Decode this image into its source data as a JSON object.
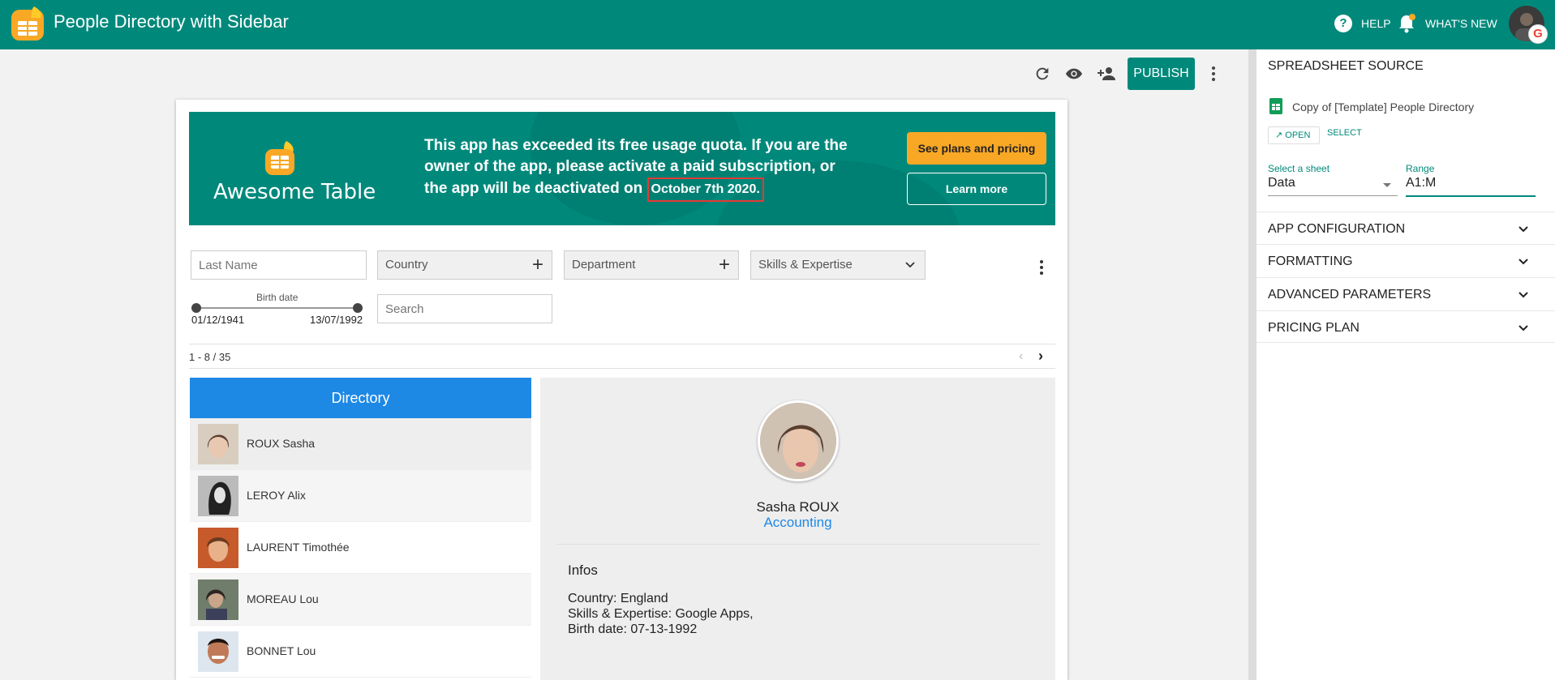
{
  "app": {
    "title": "People Directory with Sidebar"
  },
  "topbar": {
    "help_label": "HELP",
    "whats_new_label": "WHAT'S NEW",
    "google_badge": "G"
  },
  "toolbar": {
    "publish_label": "PUBLISH"
  },
  "banner": {
    "brand": "Awesome Table",
    "message": "This app has exceeded its free usage quota. If you are the owner of the app, please activate a paid subscription, or the app will be deactivated on",
    "date": "October 7th 2020.",
    "plans_label": "See plans and pricing",
    "learn_label": "Learn more"
  },
  "filters": {
    "last_name_placeholder": "Last Name",
    "country": "Country",
    "department": "Department",
    "skills": "Skills & Expertise",
    "search_placeholder": "Search",
    "birth_label": "Birth date",
    "birth_min": "01/12/1941",
    "birth_max": "13/07/1992"
  },
  "pager": {
    "count": "1 - 8 / 35"
  },
  "directory": {
    "header": "Directory",
    "people": [
      {
        "name": "ROUX Sasha"
      },
      {
        "name": "LEROY Alix"
      },
      {
        "name": "LAURENT Timothée"
      },
      {
        "name": "MOREAU Lou"
      },
      {
        "name": "BONNET Lou"
      }
    ]
  },
  "detail": {
    "name": "Sasha ROUX",
    "department": "Accounting",
    "infos_title": "Infos",
    "country": "Country: England",
    "skills": "Skills & Expertise: Google Apps,",
    "birth": "Birth date: 07-13-1992"
  },
  "sidebar": {
    "source_title": "SPREADSHEET SOURCE",
    "sheet_name": "Copy of [Template] People Directory",
    "open_label": "OPEN",
    "select_label": "SELECT",
    "select_sheet_label": "Select a sheet",
    "select_sheet_value": "Data",
    "range_label": "Range",
    "range_value": "A1:M",
    "sections": [
      "APP CONFIGURATION",
      "FORMATTING",
      "ADVANCED PARAMETERS",
      "PRICING PLAN"
    ]
  },
  "colors": {
    "primary": "#00897b",
    "accent": "#f9a825",
    "directory_header": "#1e88e5",
    "highlight": "#e53935"
  }
}
